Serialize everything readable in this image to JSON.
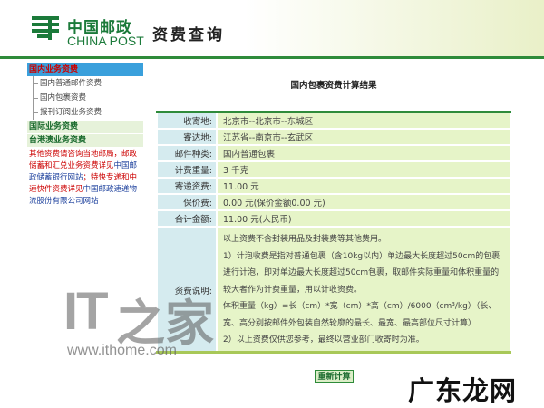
{
  "header": {
    "logo_cn": "中国邮政",
    "logo_en": "CHINA POST",
    "page_title": "资费查询"
  },
  "sidebar": {
    "categories": [
      {
        "label": "国内业务资费",
        "active": true,
        "items": [
          "国内普通邮件资费",
          "国内包裹资费",
          "报刊订阅业务资费"
        ]
      },
      {
        "label": "国际业务资费"
      },
      {
        "label": "台港澳业务资费"
      }
    ],
    "note": {
      "red1": "其他资费请咨询当地邮局，邮政储蓄和汇兑业务资费详见",
      "blue1": "中国邮政储蓄银行网站",
      "red2": "；特快专递和中速快件资费详见",
      "blue2": "中国邮政速递物流股份有限公司网站"
    }
  },
  "main": {
    "title": "国内包裹资费计算结果",
    "rows": [
      {
        "label": "收寄地:",
        "value": "北京市--北京市--东城区"
      },
      {
        "label": "寄达地:",
        "value": "江苏省--南京市--玄武区"
      },
      {
        "label": "邮件种类:",
        "value": "国内普通包裹"
      },
      {
        "label": "计费重量:",
        "value": "3 千克"
      },
      {
        "label": "寄递资费:",
        "value": "11.00 元"
      },
      {
        "label": "保价费:",
        "value": "0.00 元(保价金额0.00 元)"
      },
      {
        "label": "合计金额:",
        "value": "11.00 元(人民币)"
      }
    ],
    "notes_label": "资费说明:",
    "notes": [
      "以上资费不含封装用品及封装费等其他费用。",
      "1）计泡收费是指对普通包裹（含10kg以内）单边最大长度超过50cm的包裹进行计泡，即对单边最大长度超过50cm包裹，取邮件实际重量和体积重量的较大者作为计费重量，用以计收资费。",
      "体积重量（kg）=长（cm）*宽（cm）*高（cm）/6000（cm³/kg）（长、宽、高分别按邮件外包装自然轮廓的最长、最宽、最高部位尺寸计算）",
      "2）以上资费仅供您参考，最终以营业部门收寄时为准。"
    ],
    "recalc_label": "重新计算"
  },
  "watermarks": {
    "it": "IT",
    "zhi": "之家",
    "url": "www.ithome.com",
    "site": "广东龙网"
  },
  "colors": {
    "brand_green": "#1b7a3a",
    "label_bg": "#d5ebef",
    "value_bg": "#e6f4c8",
    "active_tab": "#3aa0dc"
  }
}
